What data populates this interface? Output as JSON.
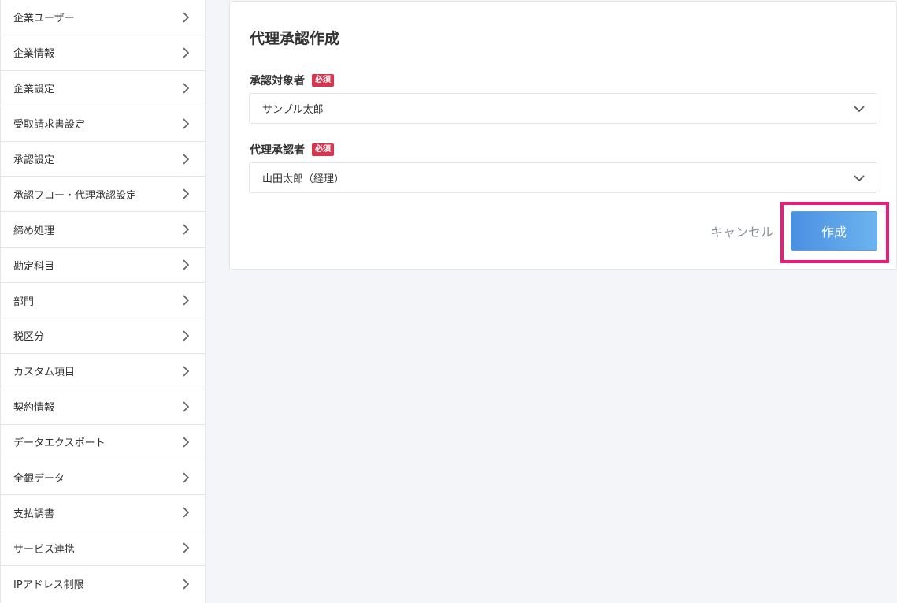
{
  "sidebar": {
    "items": [
      {
        "label": "企業ユーザー"
      },
      {
        "label": "企業情報"
      },
      {
        "label": "企業設定"
      },
      {
        "label": "受取請求書設定"
      },
      {
        "label": "承認設定"
      },
      {
        "label": "承認フロー・代理承認設定"
      },
      {
        "label": "締め処理"
      },
      {
        "label": "勘定科目"
      },
      {
        "label": "部門"
      },
      {
        "label": "税区分"
      },
      {
        "label": "カスタム項目"
      },
      {
        "label": "契約情報"
      },
      {
        "label": "データエクスポート"
      },
      {
        "label": "全銀データ"
      },
      {
        "label": "支払調書"
      },
      {
        "label": "サービス連携"
      },
      {
        "label": "IPアドレス制限"
      }
    ]
  },
  "form": {
    "title": "代理承認作成",
    "approver_target": {
      "label": "承認対象者",
      "required_badge": "必須",
      "selected_value": "サンプル太郎"
    },
    "proxy_approver": {
      "label": "代理承認者",
      "required_badge": "必須",
      "selected_value": "山田太郎（経理）"
    },
    "cancel_label": "キャンセル",
    "create_label": "作成"
  },
  "colors": {
    "required_badge": "#d8344e",
    "primary_button": "#4a90e2",
    "highlight_frame": "#ea1e78"
  }
}
